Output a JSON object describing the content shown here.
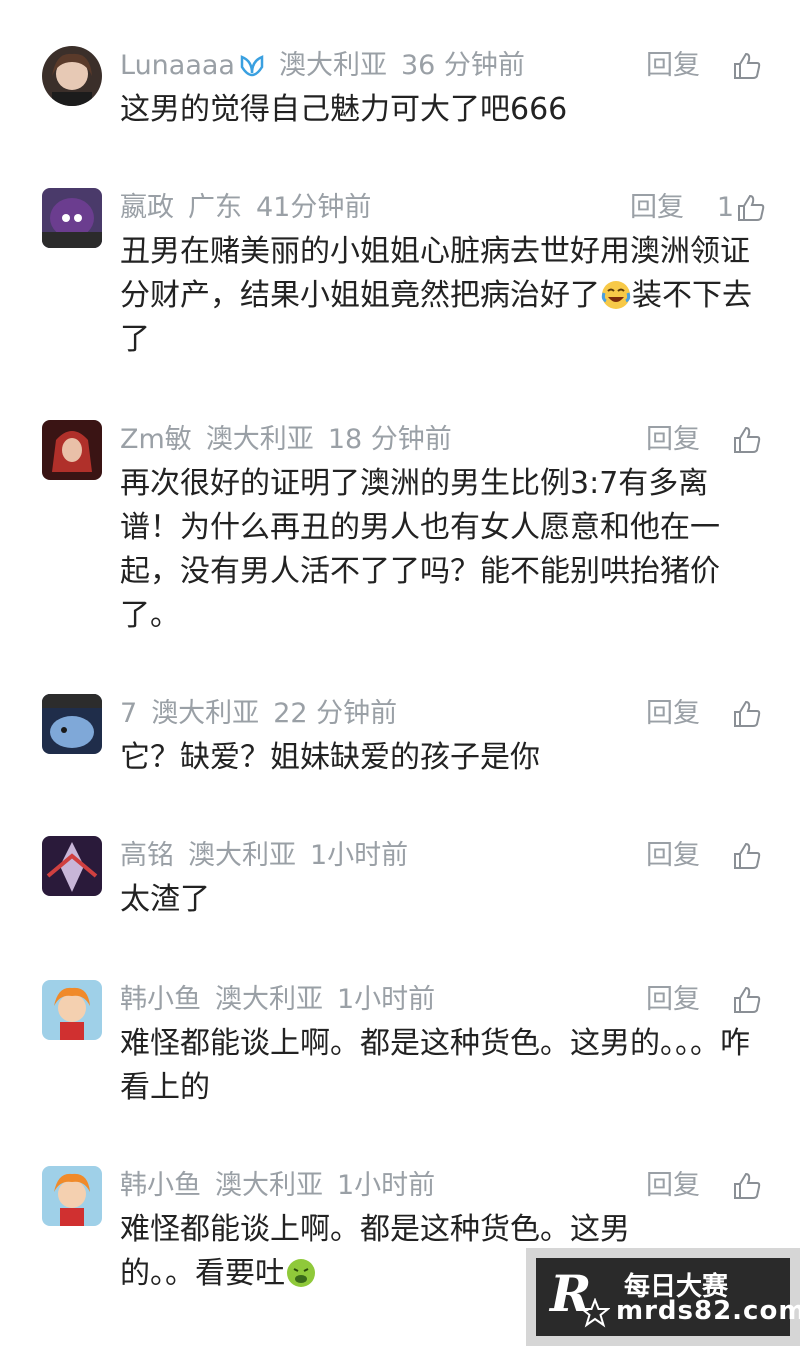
{
  "comments": [
    {
      "user": "Lunaaaa",
      "verified": true,
      "location": "澳大利亚",
      "time": "36 分钟前",
      "reply_label": "回复",
      "likes": "",
      "text_parts": [
        "这男的觉得自己魅力可大了吧666"
      ],
      "emoji": []
    },
    {
      "user": "嬴政",
      "verified": false,
      "location": "广东",
      "time": "41分钟前",
      "reply_label": "回复",
      "likes": "1",
      "text_parts": [
        "丑男在赌美丽的小姐姐心脏病去世好用澳洲领证分财产，结果小姐姐竟然把病治好了",
        "装不下去了"
      ],
      "emoji": [
        "laughing-tears-emoji"
      ]
    },
    {
      "user": "Zm敏",
      "verified": false,
      "location": "澳大利亚",
      "time": "18 分钟前",
      "reply_label": "回复",
      "likes": "",
      "text_parts": [
        "再次很好的证明了澳洲的男生比例3:7有多离谱！为什么再丑的男人也有女人愿意和他在一起，没有男人活不了了吗？能不能别哄抬猪价了。"
      ],
      "emoji": []
    },
    {
      "user": "7",
      "verified": false,
      "location": "澳大利亚",
      "time": "22 分钟前",
      "reply_label": "回复",
      "likes": "",
      "text_parts": [
        "它？缺爱？姐妹缺爱的孩子是你"
      ],
      "emoji": []
    },
    {
      "user": "高铭",
      "verified": false,
      "location": "澳大利亚",
      "time": "1小时前",
      "reply_label": "回复",
      "likes": "",
      "text_parts": [
        "太渣了"
      ],
      "emoji": []
    },
    {
      "user": "韩小鱼",
      "verified": false,
      "location": "澳大利亚",
      "time": "1小时前",
      "reply_label": "回复",
      "likes": "",
      "text_parts": [
        "难怪都能谈上啊。都是这种货色。这男的。。。咋看上的"
      ],
      "emoji": []
    },
    {
      "user": "韩小鱼",
      "verified": false,
      "location": "澳大利亚",
      "time": "1小时前",
      "reply_label": "回复",
      "likes": "",
      "text_parts": [
        "难怪都能谈上啊。都是这种货色。这男的。。看要吐",
        ""
      ],
      "emoji": [
        "nauseated-emoji"
      ]
    }
  ],
  "watermark": {
    "logo_letter": "R",
    "line1": "每日大赛",
    "line2": "mrds82.com"
  },
  "colors": {
    "meta_gray": "#9aa0a6",
    "text": "#222222",
    "verified_badge": "#3aa0e0"
  }
}
